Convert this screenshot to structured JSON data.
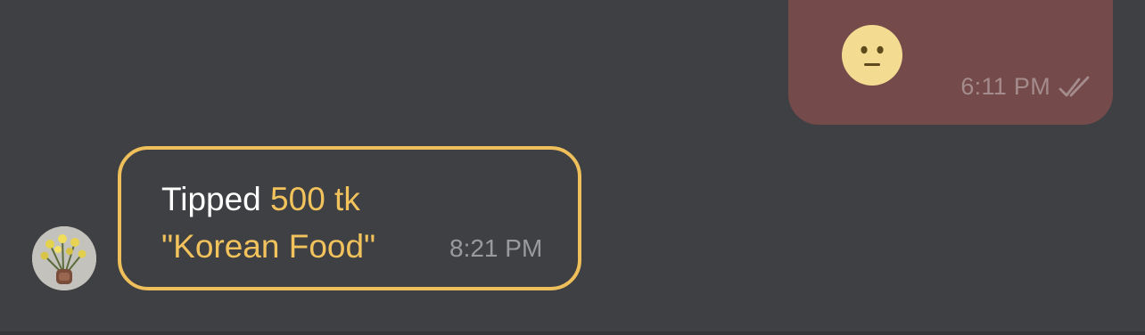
{
  "outgoing_message": {
    "emoji": "neutral-face-icon",
    "time": "6:11 PM",
    "status_icon": "double-check-icon",
    "bubble_color": "#744a4b"
  },
  "incoming_tip": {
    "avatar": "avatar",
    "prefix": "Tipped",
    "amount": "500 tk",
    "note": "\"Korean Food\"",
    "time": "8:21 PM",
    "accent_color": "#efbf5b"
  }
}
